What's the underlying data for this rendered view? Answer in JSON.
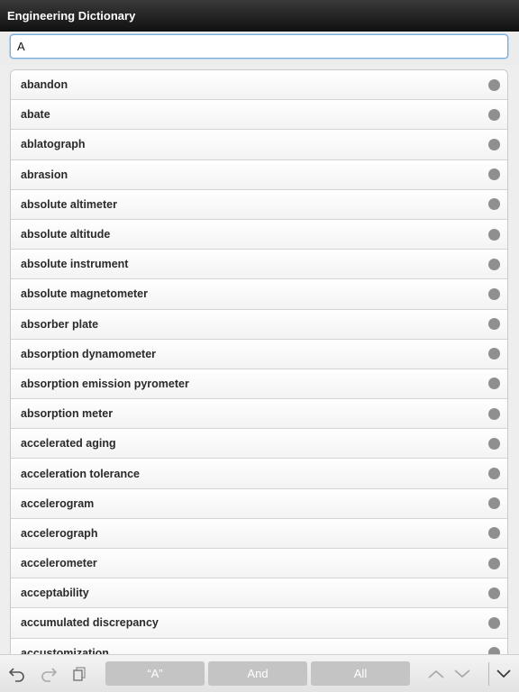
{
  "app": {
    "title": "Engineering Dictionary"
  },
  "search": {
    "value": "A"
  },
  "list": {
    "items": [
      "abandon",
      "abate",
      "ablatograph",
      "abrasion",
      "absolute altimeter",
      "absolute altitude",
      "absolute instrument",
      "absolute magnetometer",
      "absorber plate",
      "absorption dynamometer",
      "absorption emission pyrometer",
      "absorption meter",
      "accelerated aging",
      "acceleration tolerance",
      "accelerogram",
      "accelerograph",
      "accelerometer",
      "acceptability",
      "accumulated discrepancy",
      "accustomization"
    ]
  },
  "toolbar": {
    "segments": {
      "quoted": "“A”",
      "and": "And",
      "all": "All"
    },
    "icons": [
      "undo-icon",
      "redo-icon",
      "copy-icon",
      "chevron-up-icon",
      "chevron-down-icon",
      "collapse-down-icon"
    ]
  },
  "colors": {
    "titlebar": "#1a1a1a",
    "search_border": "#7eaad8",
    "dot": "#8f8f8f",
    "segment": "#c4c4c4"
  }
}
